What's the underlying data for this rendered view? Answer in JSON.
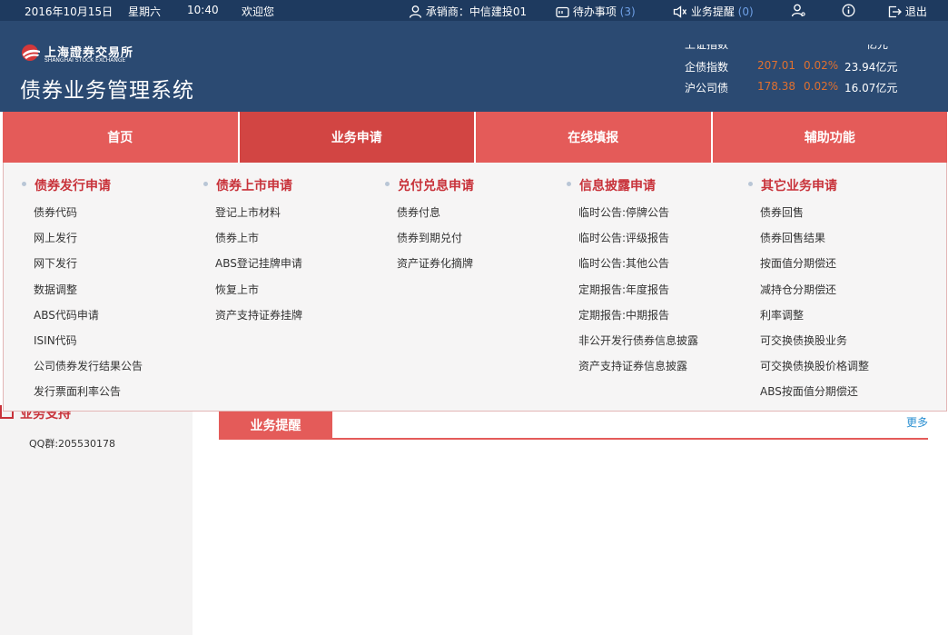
{
  "topbar": {
    "date": "2016年10月15日",
    "weekday": "星期六",
    "time": "10:40",
    "welcome": "欢迎您",
    "underwriter_label": "承销商：",
    "underwriter_name": "中信建投01",
    "todo_label": "待办事项",
    "todo_count": "(3)",
    "reminder_label": "业务提醒",
    "reminder_count": "(0)",
    "logout_label": "退出"
  },
  "header": {
    "logo_cn": "上海證券交易所",
    "logo_en": "SHANGHAI STOCK EXCHANGE",
    "system_title": "债券业务管理系统",
    "indices": [
      {
        "name": "上证指数",
        "value": "",
        "change": "",
        "amount": "亿元"
      },
      {
        "name": "企债指数",
        "value": "207.01",
        "change": "0.02%",
        "amount": "23.94亿元"
      },
      {
        "name": "沪公司债",
        "value": "178.38",
        "change": "0.02%",
        "amount": "16.07亿元"
      }
    ]
  },
  "nav": {
    "tabs": [
      {
        "label": "首页",
        "active": false
      },
      {
        "label": "业务申请",
        "active": true
      },
      {
        "label": "在线填报",
        "active": false
      },
      {
        "label": "辅助功能",
        "active": false
      }
    ]
  },
  "menu": {
    "columns": [
      {
        "title": "债券发行申请",
        "items": [
          "债券代码",
          "网上发行",
          "网下发行",
          "数据调整",
          "ABS代码申请",
          "ISIN代码",
          "公司债券发行结果公告",
          "发行票面利率公告"
        ]
      },
      {
        "title": "债券上市申请",
        "items": [
          "登记上市材料",
          "债券上市",
          "ABS登记挂牌申请",
          "恢复上市",
          "资产支持证券挂牌"
        ]
      },
      {
        "title": "兑付兑息申请",
        "items": [
          "债券付息",
          "债券到期兑付",
          "资产证券化摘牌"
        ]
      },
      {
        "title": "信息披露申请",
        "items": [
          "临时公告:停牌公告",
          "临时公告:评级报告",
          "临时公告:其他公告",
          "定期报告:年度报告",
          "定期报告:中期报告",
          "非公开发行债券信息披露",
          "资产支持证券信息披露"
        ]
      },
      {
        "title": "其它业务申请",
        "items": [
          "债券回售",
          "债券回售结果",
          "按面值分期偿还",
          "减持仓分期偿还",
          "利率调整",
          "可交换债换股业务",
          "可交换债换股价格调整",
          "ABS按面值分期偿还"
        ]
      }
    ]
  },
  "sidebar": {
    "title": "业务支持",
    "qq": "QQ群:205530178"
  },
  "panel": {
    "tab_label": "业务提醒",
    "more_label": "更多"
  },
  "colors": {
    "topbar_bg": "#1e3a5f",
    "header_bg": "#2b4a72",
    "nav_red": "#e45b59",
    "nav_active": "#d24543",
    "menu_title_red": "#c8323a",
    "index_orange": "#e0702f",
    "link_blue": "#2a8fd1"
  },
  "icons": [
    "user-icon",
    "todo-icon",
    "speaker-icon",
    "person-icon",
    "info-icon",
    "logout-icon",
    "sse-logo-icon"
  ]
}
